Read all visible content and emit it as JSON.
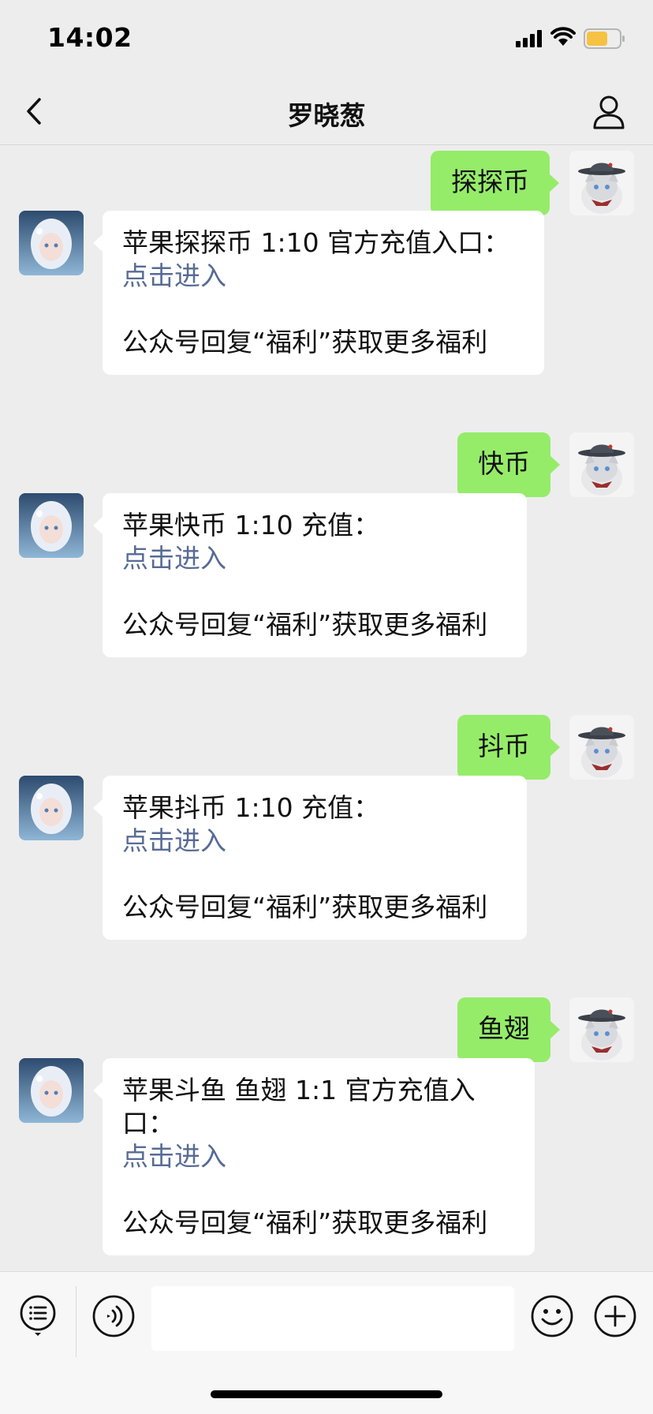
{
  "status_bar": {
    "time": "14:02",
    "icons": [
      "signal-icon",
      "wifi-icon",
      "battery-icon"
    ],
    "battery_color": "#f5c242"
  },
  "nav": {
    "title": "罗晓葱",
    "back_icon": "chevron-left-icon",
    "profile_icon": "person-icon"
  },
  "colors": {
    "background": "#ededed",
    "outgoing_bubble": "#95ec69",
    "incoming_bubble": "#ffffff",
    "link": "#576b95"
  },
  "messages": [
    {
      "direction": "out",
      "text": "探探币"
    },
    {
      "direction": "in",
      "text": "苹果探探币 1:10 官方充值入口：",
      "link": "点击进入",
      "footer": "公众号回复“福利”获取更多福利"
    },
    {
      "direction": "out",
      "text": "快币"
    },
    {
      "direction": "in",
      "text": "苹果快币 1:10 充值：",
      "link": "点击进入",
      "footer": "公众号回复“福利”获取更多福利"
    },
    {
      "direction": "out",
      "text": "抖币"
    },
    {
      "direction": "in",
      "text": "苹果抖币 1:10 充值：",
      "link": "点击进入",
      "footer": "公众号回复“福利”获取更多福利"
    },
    {
      "direction": "out",
      "text": "鱼翅"
    },
    {
      "direction": "in",
      "text": "苹果斗鱼 鱼翅 1:1 官方充值入口：",
      "link": "点击进入",
      "footer": "公众号回复“福利”获取更多福利"
    }
  ],
  "input_bar": {
    "input_value": "",
    "icons": [
      "list-icon",
      "voice-icon",
      "emoji-icon",
      "plus-icon"
    ]
  }
}
